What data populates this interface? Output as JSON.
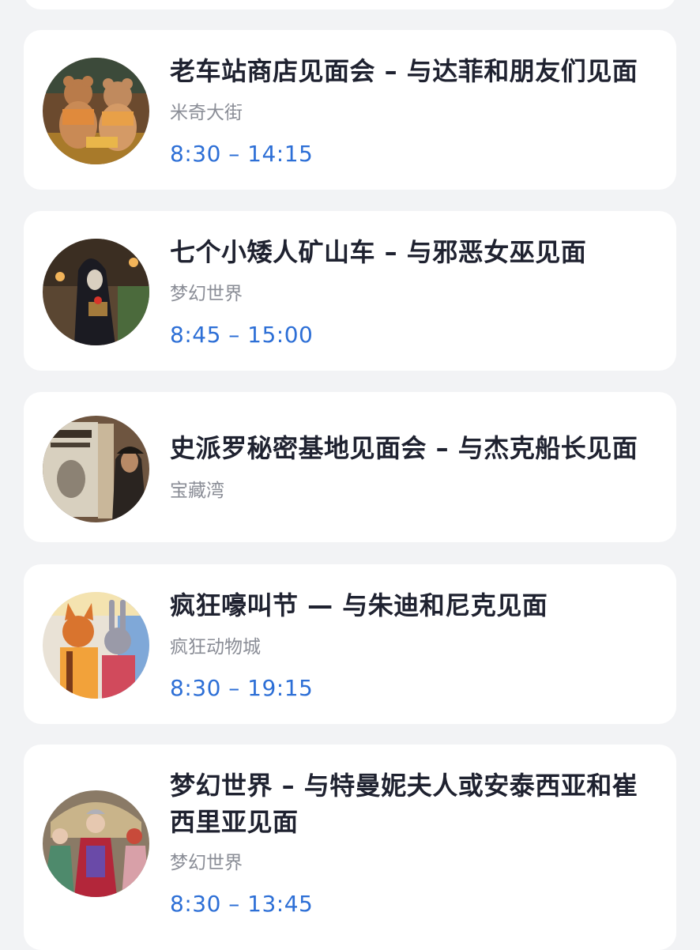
{
  "cards": [
    {
      "title": "老车站商店见面会 – 与达菲和朋友们见面",
      "location": "米奇大街",
      "time": "8:30 – 14:15",
      "avatar_icon": "duffy-friends-photo"
    },
    {
      "title": "七个小矮人矿山车 – 与邪恶女巫见面",
      "location": "梦幻世界",
      "time": "8:45 – 15:00",
      "avatar_icon": "evil-queen-witch-photo"
    },
    {
      "title": "史派罗秘密基地见面会 – 与杰克船长见面",
      "location": "宝藏湾",
      "time": "",
      "avatar_icon": "captain-jack-sparrow-photo"
    },
    {
      "title": "疯狂嚎叫节 — 与朱迪和尼克见面",
      "location": "疯狂动物城",
      "time": "8:30 – 19:15",
      "avatar_icon": "judy-nick-photo"
    },
    {
      "title": "梦幻世界 – 与特曼妮夫人或安泰西亚和崔西里亚见面",
      "location": "梦幻世界",
      "time": "8:30 – 13:45",
      "avatar_icon": "tremaine-stepsisters-photo"
    }
  ]
}
